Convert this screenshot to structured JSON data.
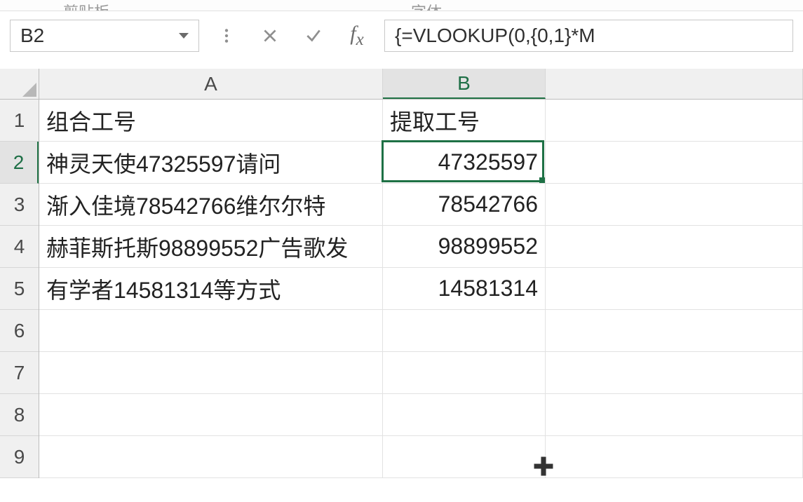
{
  "ribbon_groups": {
    "g1": "剪贴板",
    "g2": "字体"
  },
  "name_box": {
    "value": "B2"
  },
  "formula_bar": {
    "value": "{=VLOOKUP(0,{0,1}*M"
  },
  "columns": [
    {
      "id": "A",
      "label": "A",
      "selected": false
    },
    {
      "id": "B",
      "label": "B",
      "selected": true
    },
    {
      "id": "C",
      "label": "",
      "selected": false
    }
  ],
  "rows": [
    {
      "num": "1",
      "selected": false,
      "A": "组合工号",
      "B": "提取工号",
      "B_align": "left"
    },
    {
      "num": "2",
      "selected": true,
      "A": "神灵天使47325597请问",
      "B": "47325597",
      "B_align": "right"
    },
    {
      "num": "3",
      "selected": false,
      "A": "渐入佳境78542766维尔尔特",
      "B": "78542766",
      "B_align": "right"
    },
    {
      "num": "4",
      "selected": false,
      "A": "赫菲斯托斯98899552广告歌发",
      "B": "98899552",
      "B_align": "right"
    },
    {
      "num": "5",
      "selected": false,
      "A": "有学者14581314等方式",
      "B": "14581314",
      "B_align": "right"
    },
    {
      "num": "6",
      "selected": false,
      "A": "",
      "B": "",
      "B_align": "left"
    },
    {
      "num": "7",
      "selected": false,
      "A": "",
      "B": "",
      "B_align": "left"
    },
    {
      "num": "8",
      "selected": false,
      "A": "",
      "B": "",
      "B_align": "left"
    },
    {
      "num": "9",
      "selected": false,
      "A": "",
      "B": "",
      "B_align": "left"
    }
  ],
  "active_cell": {
    "row": 2,
    "col": "B"
  }
}
